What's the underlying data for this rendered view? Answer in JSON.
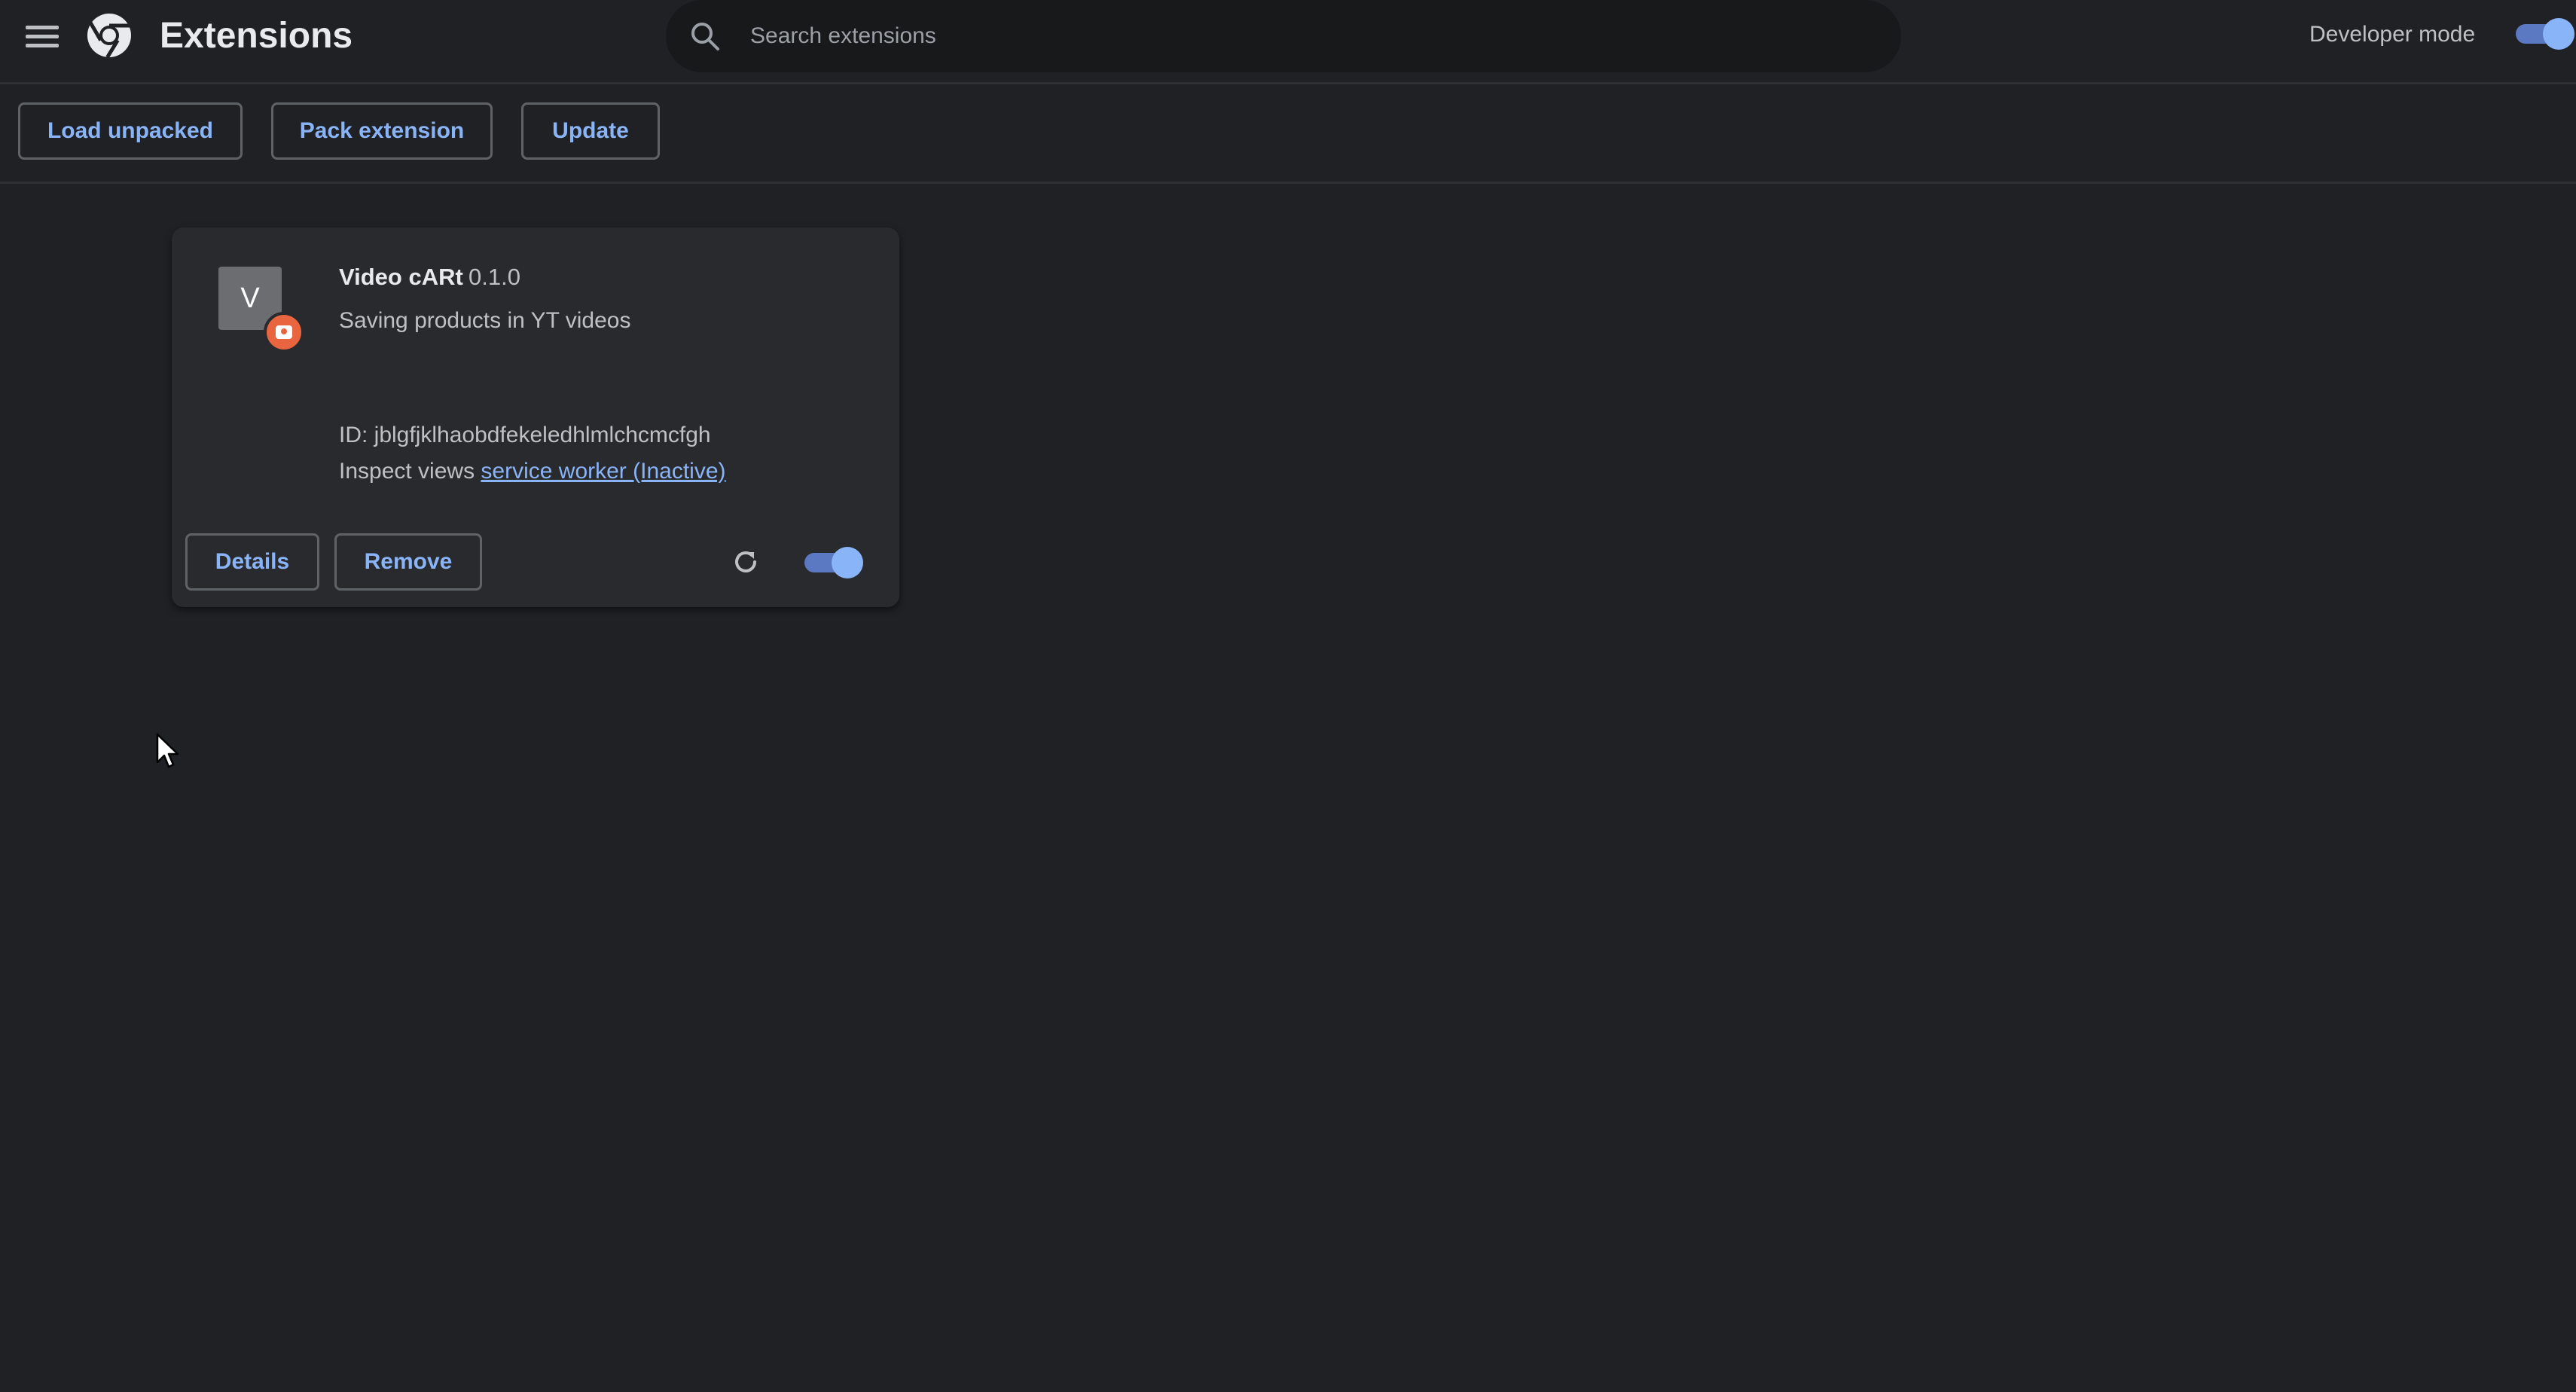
{
  "header": {
    "title": "Extensions",
    "menu_icon": "hamburger-menu-icon",
    "logo_icon": "chrome-logo-icon",
    "search": {
      "placeholder": "Search extensions",
      "value": "",
      "icon": "search-icon"
    },
    "developer_mode": {
      "label": "Developer mode",
      "enabled": true
    }
  },
  "toolbar": {
    "load_unpacked_label": "Load unpacked",
    "pack_extension_label": "Pack extension",
    "update_label": "Update"
  },
  "extensions": [
    {
      "icon_letter": "V",
      "badge_icon": "camera-badge-icon",
      "name": "Video cARt",
      "version": "0.1.0",
      "description": "Saving products in YT videos",
      "id_text": "ID: jblgfjklhaobdfekeledhlmlchcmcfgh",
      "inspect_label": "Inspect views",
      "inspect_link": "service worker (Inactive)",
      "details_label": "Details",
      "remove_label": "Remove",
      "reload_icon": "reload-icon",
      "enabled": true
    }
  ],
  "colors": {
    "background": "#202124",
    "card": "#292a2d",
    "accent": "#8ab4f8",
    "toggle_track": "#5b78c2",
    "badge": "#e8653f"
  }
}
